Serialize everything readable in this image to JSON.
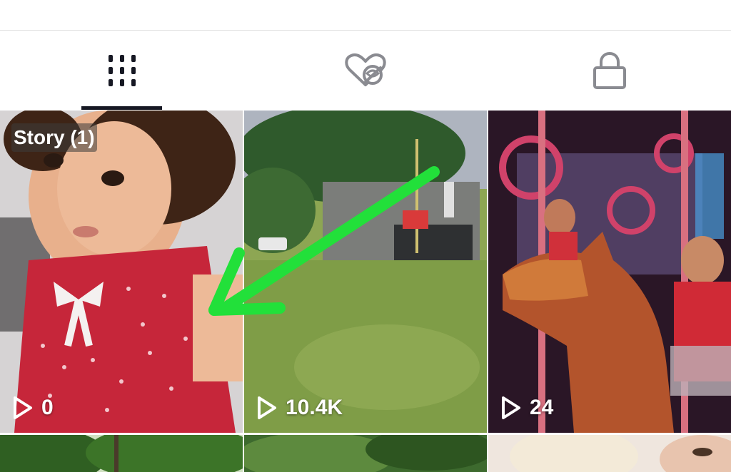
{
  "tabs": [
    {
      "name": "videos",
      "icon": "grid-bars-icon",
      "active": true
    },
    {
      "name": "liked",
      "icon": "heart-hidden-icon",
      "active": false
    },
    {
      "name": "private",
      "icon": "lock-icon",
      "active": false
    }
  ],
  "videos": [
    {
      "badge": "Story (1)",
      "views": "0"
    },
    {
      "badge": "",
      "views": "10.4K"
    },
    {
      "badge": "",
      "views": "24"
    },
    {
      "views": ""
    },
    {
      "views": ""
    },
    {
      "views": ""
    }
  ],
  "colors": {
    "active_indicator": "#161823",
    "icon_gray": "#8a8b91",
    "annotation_arrow": "#22e03a"
  }
}
